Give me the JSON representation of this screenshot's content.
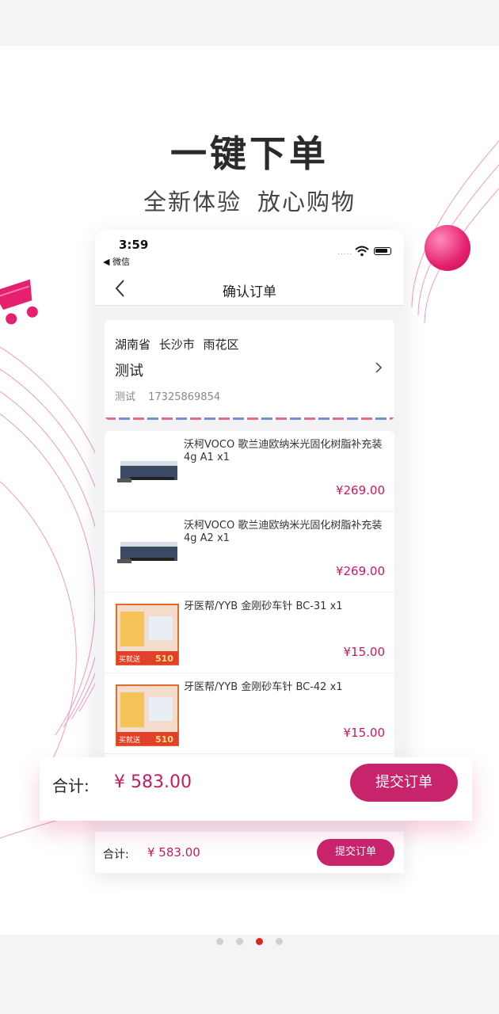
{
  "banner": {
    "headline": "一键下单",
    "subline_a": "全新体验",
    "subline_b": "放心购物"
  },
  "status_bar": {
    "time": "3:59",
    "back_app": "◀ 微信",
    "signal": "....."
  },
  "nav": {
    "title": "确认订单",
    "back_icon": "chevron-left-icon"
  },
  "address": {
    "region": "湖南省 长沙市 雨花区",
    "name": "测试",
    "contact": "测试 17325869854",
    "arrow_icon": "chevron-right-icon"
  },
  "items": [
    {
      "name": "沃柯VOCO 歌兰迪欧纳米光固化树脂补充装4g A1  x1",
      "price": "¥269.00",
      "thumb": "resin-syringe-box"
    },
    {
      "name": "沃柯VOCO 歌兰迪欧纳米光固化树脂补充装4g A2  x1",
      "price": "¥269.00",
      "thumb": "resin-syringe-box"
    },
    {
      "name": "牙医帮/YYB 金刚砂车针 BC-31  x1",
      "price": "¥15.00",
      "thumb": "bur-promo-box",
      "promo_left": "买就送",
      "promo_right": "510"
    },
    {
      "name": "牙医帮/YYB 金刚砂车针 BC-42  x1",
      "price": "¥15.00",
      "thumb": "bur-promo-box",
      "promo_left": "买就送",
      "promo_right": "510"
    }
  ],
  "order_bar": {
    "label": "合计:",
    "total": "¥ 583.00",
    "submit": "提交订单"
  },
  "pager": {
    "count": 4,
    "active_index": 2
  },
  "colors": {
    "accent": "#c8246c",
    "price": "#c21c62",
    "ball": "#e5206f",
    "active_dot": "#d8281f"
  }
}
